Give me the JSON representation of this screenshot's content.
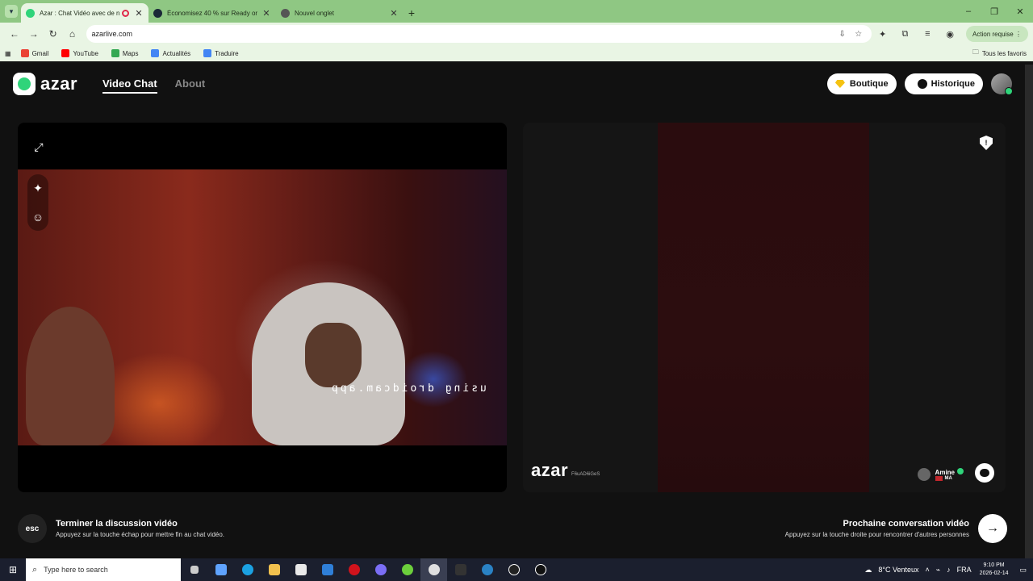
{
  "browser": {
    "tabs": [
      {
        "title": "Azar : Chat Vidéo avec de n",
        "active": true,
        "recording": true
      },
      {
        "title": "Économisez 40 % sur Ready or",
        "active": false
      },
      {
        "title": "Nouvel onglet",
        "active": false
      }
    ],
    "url": "azarlive.com",
    "action_button": "Action requise",
    "bookmarks": [
      "Gmail",
      "YouTube",
      "Maps",
      "Actualités",
      "Traduire"
    ],
    "all_bookmarks": "Tous les favoris"
  },
  "site": {
    "logo": "azar",
    "nav": {
      "video_chat": "Video Chat",
      "about": "About"
    },
    "boutique": "Boutique",
    "historique": "Historique",
    "overlay_text": "using droidcam.app",
    "watermark_brand": "azar",
    "watermark_code": "F6uAD6iGeS",
    "peer": {
      "name": "Amine",
      "country": "MA"
    },
    "end_call": {
      "key": "esc",
      "title": "Terminer la discussion vidéo",
      "subtitle": "Appuyez sur la touche échap pour mettre fin au chat vidéo."
    },
    "next_call": {
      "title": "Prochaine conversation vidéo",
      "subtitle": "Appuyez sur la touche droite pour rencontrer d'autres personnes"
    }
  },
  "taskbar": {
    "search_placeholder": "Type here to search",
    "weather": "8°C Venteux",
    "language": "FRA",
    "time": "9:10 PM",
    "date": "2026-02-14"
  },
  "colors": {
    "accent": "#2fd47a",
    "chrome": "#8fc783",
    "bg": "#111111"
  }
}
